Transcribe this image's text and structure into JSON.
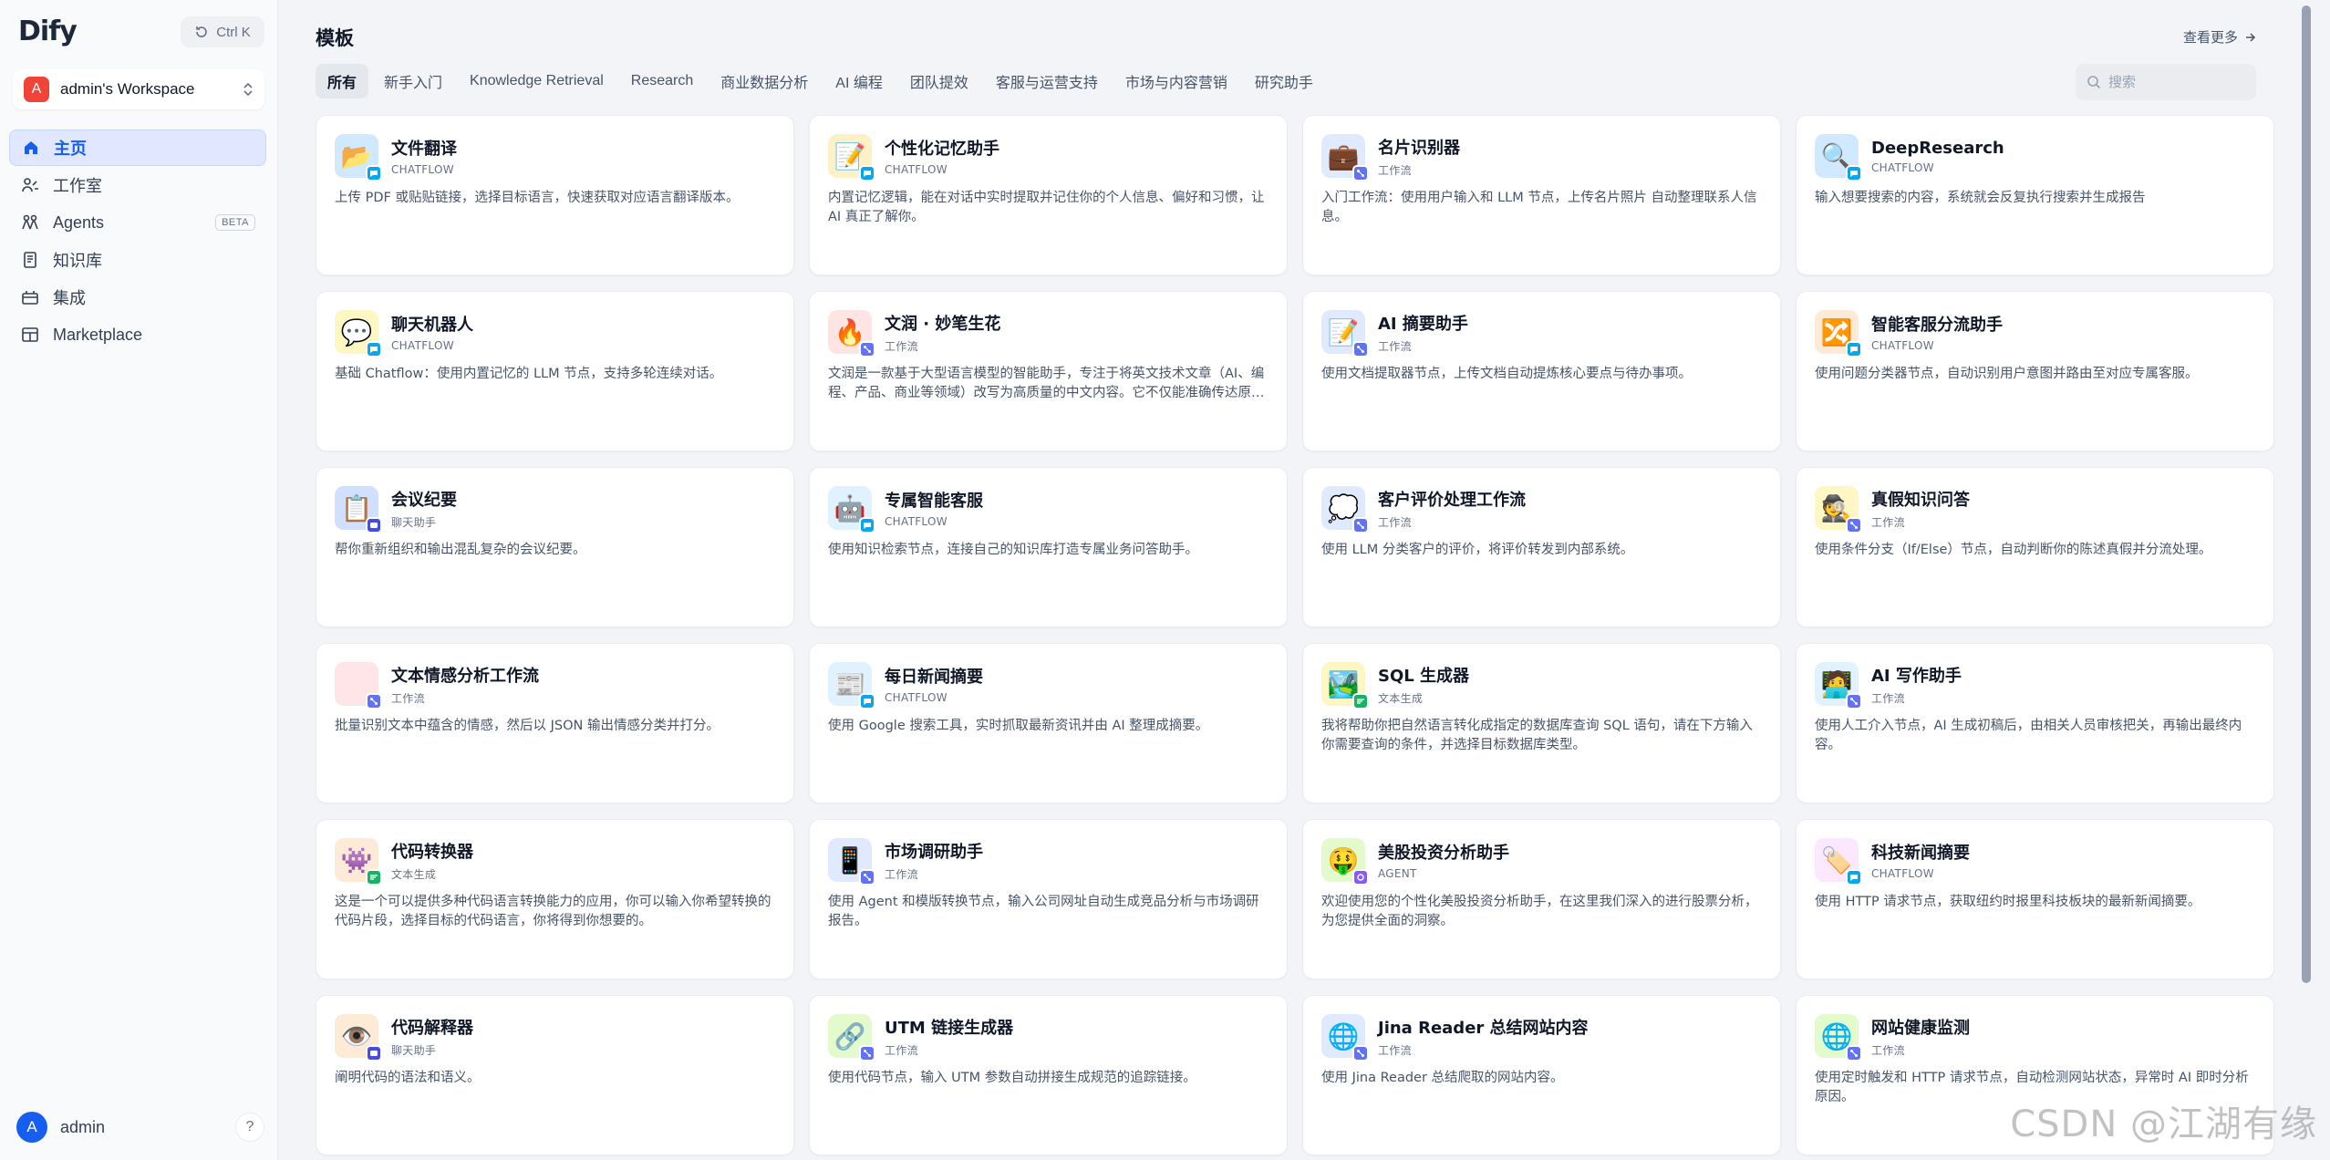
{
  "app": {
    "logo": "Dify",
    "shortcut": "Ctrl K"
  },
  "workspace": {
    "initial": "A",
    "name": "admin's Workspace"
  },
  "nav": [
    {
      "id": "home",
      "label": "主页",
      "icon": "home-icon",
      "active": true
    },
    {
      "id": "studio",
      "label": "工作室",
      "icon": "studio-icon"
    },
    {
      "id": "agents",
      "label": "Agents",
      "icon": "agents-icon",
      "badge": "BETA"
    },
    {
      "id": "knowledge",
      "label": "知识库",
      "icon": "knowledge-icon"
    },
    {
      "id": "integrations",
      "label": "集成",
      "icon": "integration-icon"
    },
    {
      "id": "marketplace",
      "label": "Marketplace",
      "icon": "marketplace-icon"
    }
  ],
  "user": {
    "initial": "A",
    "name": "admin",
    "help": "?"
  },
  "main": {
    "title": "模板",
    "more": "查看更多",
    "search_placeholder": "搜索",
    "tabs": [
      "所有",
      "新手入门",
      "Knowledge Retrieval",
      "Research",
      "商业数据分析",
      "AI 编程",
      "团队提效",
      "客服与运营支持",
      "市场与内容营销",
      "研究助手"
    ]
  },
  "cards": [
    {
      "title": "文件翻译",
      "mode": "CHATFLOW",
      "kind": "chatflow",
      "emoji": "📂",
      "bg": "#d1e9ff",
      "desc": "上传 PDF 或贴贴链接，选择目标语言，快速获取对应语言翻译版本。"
    },
    {
      "title": "个性化记忆助手",
      "mode": "CHATFLOW",
      "kind": "chatflow",
      "emoji": "📝",
      "bg": "#fef0c7",
      "desc": "内置记忆逻辑，能在对话中实时提取并记住你的个人信息、偏好和习惯，让 AI 真正了解你。"
    },
    {
      "title": "名片识别器",
      "mode": "工作流",
      "kind": "workflow",
      "emoji": "💼",
      "bg": "#e0eaff",
      "desc": "入门工作流：使用用户输入和 LLM 节点，上传名片照片 自动整理联系人信息。"
    },
    {
      "title": "DeepResearch",
      "mode": "CHATFLOW",
      "kind": "chatflow",
      "emoji": "🔍",
      "bg": "#d1e9ff",
      "desc": "输入想要搜索的内容，系统就会反复执行搜索并生成报告"
    },
    {
      "title": "聊天机器人",
      "mode": "CHATFLOW",
      "kind": "chatflow",
      "emoji": "💬",
      "bg": "#fef7c3",
      "desc": "基础 Chatflow：使用内置记忆的 LLM 节点，支持多轮连续对话。"
    },
    {
      "title": "文润 · 妙笔生花",
      "mode": "工作流",
      "kind": "workflow",
      "emoji": "🔥",
      "bg": "#fee4e2",
      "desc": "文润是一款基于大型语言模型的智能助手，专注于将英文技术文章（AI、编程、产品、商业等领域）改写为高质量的中文内容。它不仅能准确传达原文含义，更能让文章读起来自然流畅。"
    },
    {
      "title": "AI 摘要助手",
      "mode": "工作流",
      "kind": "workflow",
      "emoji": "📝",
      "bg": "#e0eaff",
      "desc": "使用文档提取器节点，上传文档自动提炼核心要点与待办事项。"
    },
    {
      "title": "智能客服分流助手",
      "mode": "CHATFLOW",
      "kind": "chatflow",
      "emoji": "🔀",
      "bg": "#fdead7",
      "desc": "使用问题分类器节点，自动识别用户意图并路由至对应专属客服。"
    },
    {
      "title": "会议纪要",
      "mode": "聊天助手",
      "kind": "chatbot",
      "emoji": "📋",
      "bg": "#d1e0ff",
      "desc": "帮你重新组织和输出混乱复杂的会议纪要。"
    },
    {
      "title": "专属智能客服",
      "mode": "CHATFLOW",
      "kind": "chatflow",
      "emoji": "🤖",
      "bg": "#e0f2fe",
      "desc": "使用知识检索节点，连接自己的知识库打造专属业务问答助手。"
    },
    {
      "title": "客户评价处理工作流",
      "mode": "工作流",
      "kind": "workflow",
      "emoji": "💭",
      "bg": "#e0eaff",
      "desc": "使用 LLM 分类客户的评价，将评价转发到内部系统。"
    },
    {
      "title": "真假知识问答",
      "mode": "工作流",
      "kind": "workflow",
      "emoji": "🕵️",
      "bg": "#fef7c3",
      "desc": "使用条件分支（If/Else）节点，自动判断你的陈述真假并分流处理。"
    },
    {
      "title": "文本情感分析工作流",
      "mode": "工作流",
      "kind": "workflow",
      "emoji": "",
      "bg": "#ffe4e8",
      "desc": "批量识别文本中蕴含的情感，然后以 JSON 输出情感分类并打分。"
    },
    {
      "title": "每日新闻摘要",
      "mode": "CHATFLOW",
      "kind": "chatflow",
      "emoji": "📰",
      "bg": "#e0f2fe",
      "desc": "使用 Google 搜索工具，实时抓取最新资讯并由 AI 整理成摘要。"
    },
    {
      "title": "SQL 生成器",
      "mode": "文本生成",
      "kind": "completion",
      "emoji": "🏞️",
      "bg": "#fef7c3",
      "desc": "我将帮助你把自然语言转化成指定的数据库查询 SQL 语句，请在下方输入你需要查询的条件，并选择目标数据库类型。"
    },
    {
      "title": "AI 写作助手",
      "mode": "工作流",
      "kind": "workflow",
      "emoji": "🧑‍💻",
      "bg": "#e0f2fe",
      "desc": "使用人工介入节点，AI 生成初稿后，由相关人员审核把关，再输出最终内容。"
    },
    {
      "title": "代码转换器",
      "mode": "文本生成",
      "kind": "completion",
      "emoji": "👾",
      "bg": "#fdead7",
      "desc": "这是一个可以提供多种代码语言转换能力的应用，你可以输入你希望转换的代码片段，选择目标的代码语言，你将得到你想要的。"
    },
    {
      "title": "市场调研助手",
      "mode": "工作流",
      "kind": "workflow",
      "emoji": "📱",
      "bg": "#e0eaff",
      "desc": "使用 Agent 和模版转换节点，输入公司网址自动生成竞品分析与市场调研报告。"
    },
    {
      "title": "美股投资分析助手",
      "mode": "AGENT",
      "kind": "agent",
      "emoji": "🤑",
      "bg": "#e3fbcc",
      "desc": "欢迎使用您的个性化美股投资分析助手，在这里我们深入的进行股票分析，为您提供全面的洞察。"
    },
    {
      "title": "科技新闻摘要",
      "mode": "CHATFLOW",
      "kind": "chatflow",
      "emoji": "🏷️",
      "bg": "#fbe8ff",
      "desc": "使用 HTTP 请求节点，获取纽约时报里科技板块的最新新闻摘要。"
    },
    {
      "title": "代码解释器",
      "mode": "聊天助手",
      "kind": "chatbot",
      "emoji": "👁️",
      "bg": "#fdead7",
      "desc": "阐明代码的语法和语义。"
    },
    {
      "title": "UTM 链接生成器",
      "mode": "工作流",
      "kind": "workflow",
      "emoji": "🔗",
      "bg": "#e3fbcc",
      "desc": "使用代码节点，输入 UTM 参数自动拼接生成规范的追踪链接。"
    },
    {
      "title": "Jina Reader 总结网站内容",
      "mode": "工作流",
      "kind": "workflow",
      "emoji": "🌐",
      "bg": "#e0eaff",
      "desc": "使用 Jina Reader 总结爬取的网站内容。"
    },
    {
      "title": "网站健康监测",
      "mode": "工作流",
      "kind": "workflow",
      "emoji": "🌐",
      "bg": "#e3fbcc",
      "desc": "使用定时触发和 HTTP 请求节点，自动检测网站状态，异常时 AI 即时分析原因。"
    }
  ],
  "watermark": "CSDN @江湖有缘",
  "colors": {
    "accent": "#155eef",
    "workspace_badge": "#f04438",
    "chatflow": "#0ba5ec",
    "workflow": "#6172f3",
    "chatbot": "#444ce7",
    "completion": "#16b364",
    "agent": "#875bf7"
  }
}
